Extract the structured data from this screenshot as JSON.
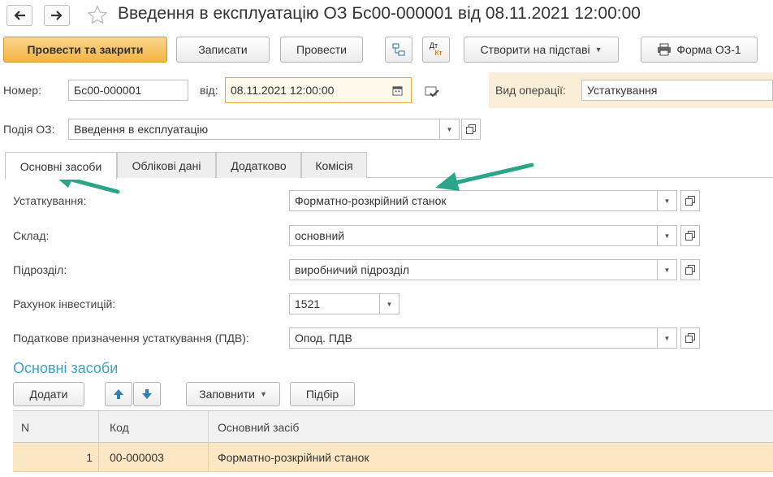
{
  "window": {
    "title": "Введення в експлуатацію ОЗ Бс00-000001 від 08.11.2021 12:00:00"
  },
  "toolbar": {
    "post_close": "Провести та закрити",
    "save": "Записати",
    "post": "Провести",
    "dt_top": "Дт",
    "dt_bottom": "Кт",
    "create_based": "Створити на підставі",
    "print_form": "Форма ОЗ-1"
  },
  "header": {
    "number_label": "Номер:",
    "number_value": "Бс00-000001",
    "date_label": "від:",
    "date_value": "08.11.2021 12:00:00",
    "operation_label": "Вид операції:",
    "operation_value": "Устаткування",
    "event_label": "Подія ОЗ:",
    "event_value": "Введення в експлуатацію"
  },
  "tabs": [
    "Основні засоби",
    "Облікові дані",
    "Додатково",
    "Комісія"
  ],
  "form": {
    "equipment_label": "Устаткування:",
    "equipment_value": "Форматно-розкрійний станок",
    "warehouse_label": "Склад:",
    "warehouse_value": "основний",
    "department_label": "Підрозділ:",
    "department_value": "виробничий підрозділ",
    "investment_label": "Рахунок інвестицій:",
    "investment_value": "1521",
    "tax_label": "Податкове призначення устаткування (ПДВ):",
    "tax_value": "Опод. ПДВ"
  },
  "assets": {
    "title": "Основні засоби",
    "add": "Додати",
    "fill": "Заповнити",
    "pick": "Підбір",
    "columns": [
      "N",
      "Код",
      "Основний засіб"
    ],
    "rows": [
      {
        "n": "1",
        "code": "00-000003",
        "asset": "Форматно-розкрійний станок"
      }
    ]
  },
  "colors": {
    "primary_button": "#f3b443",
    "section_title": "#3aa3c2",
    "annotation_arrow": "#2aa58a",
    "selected_row": "#fbe7c3"
  }
}
